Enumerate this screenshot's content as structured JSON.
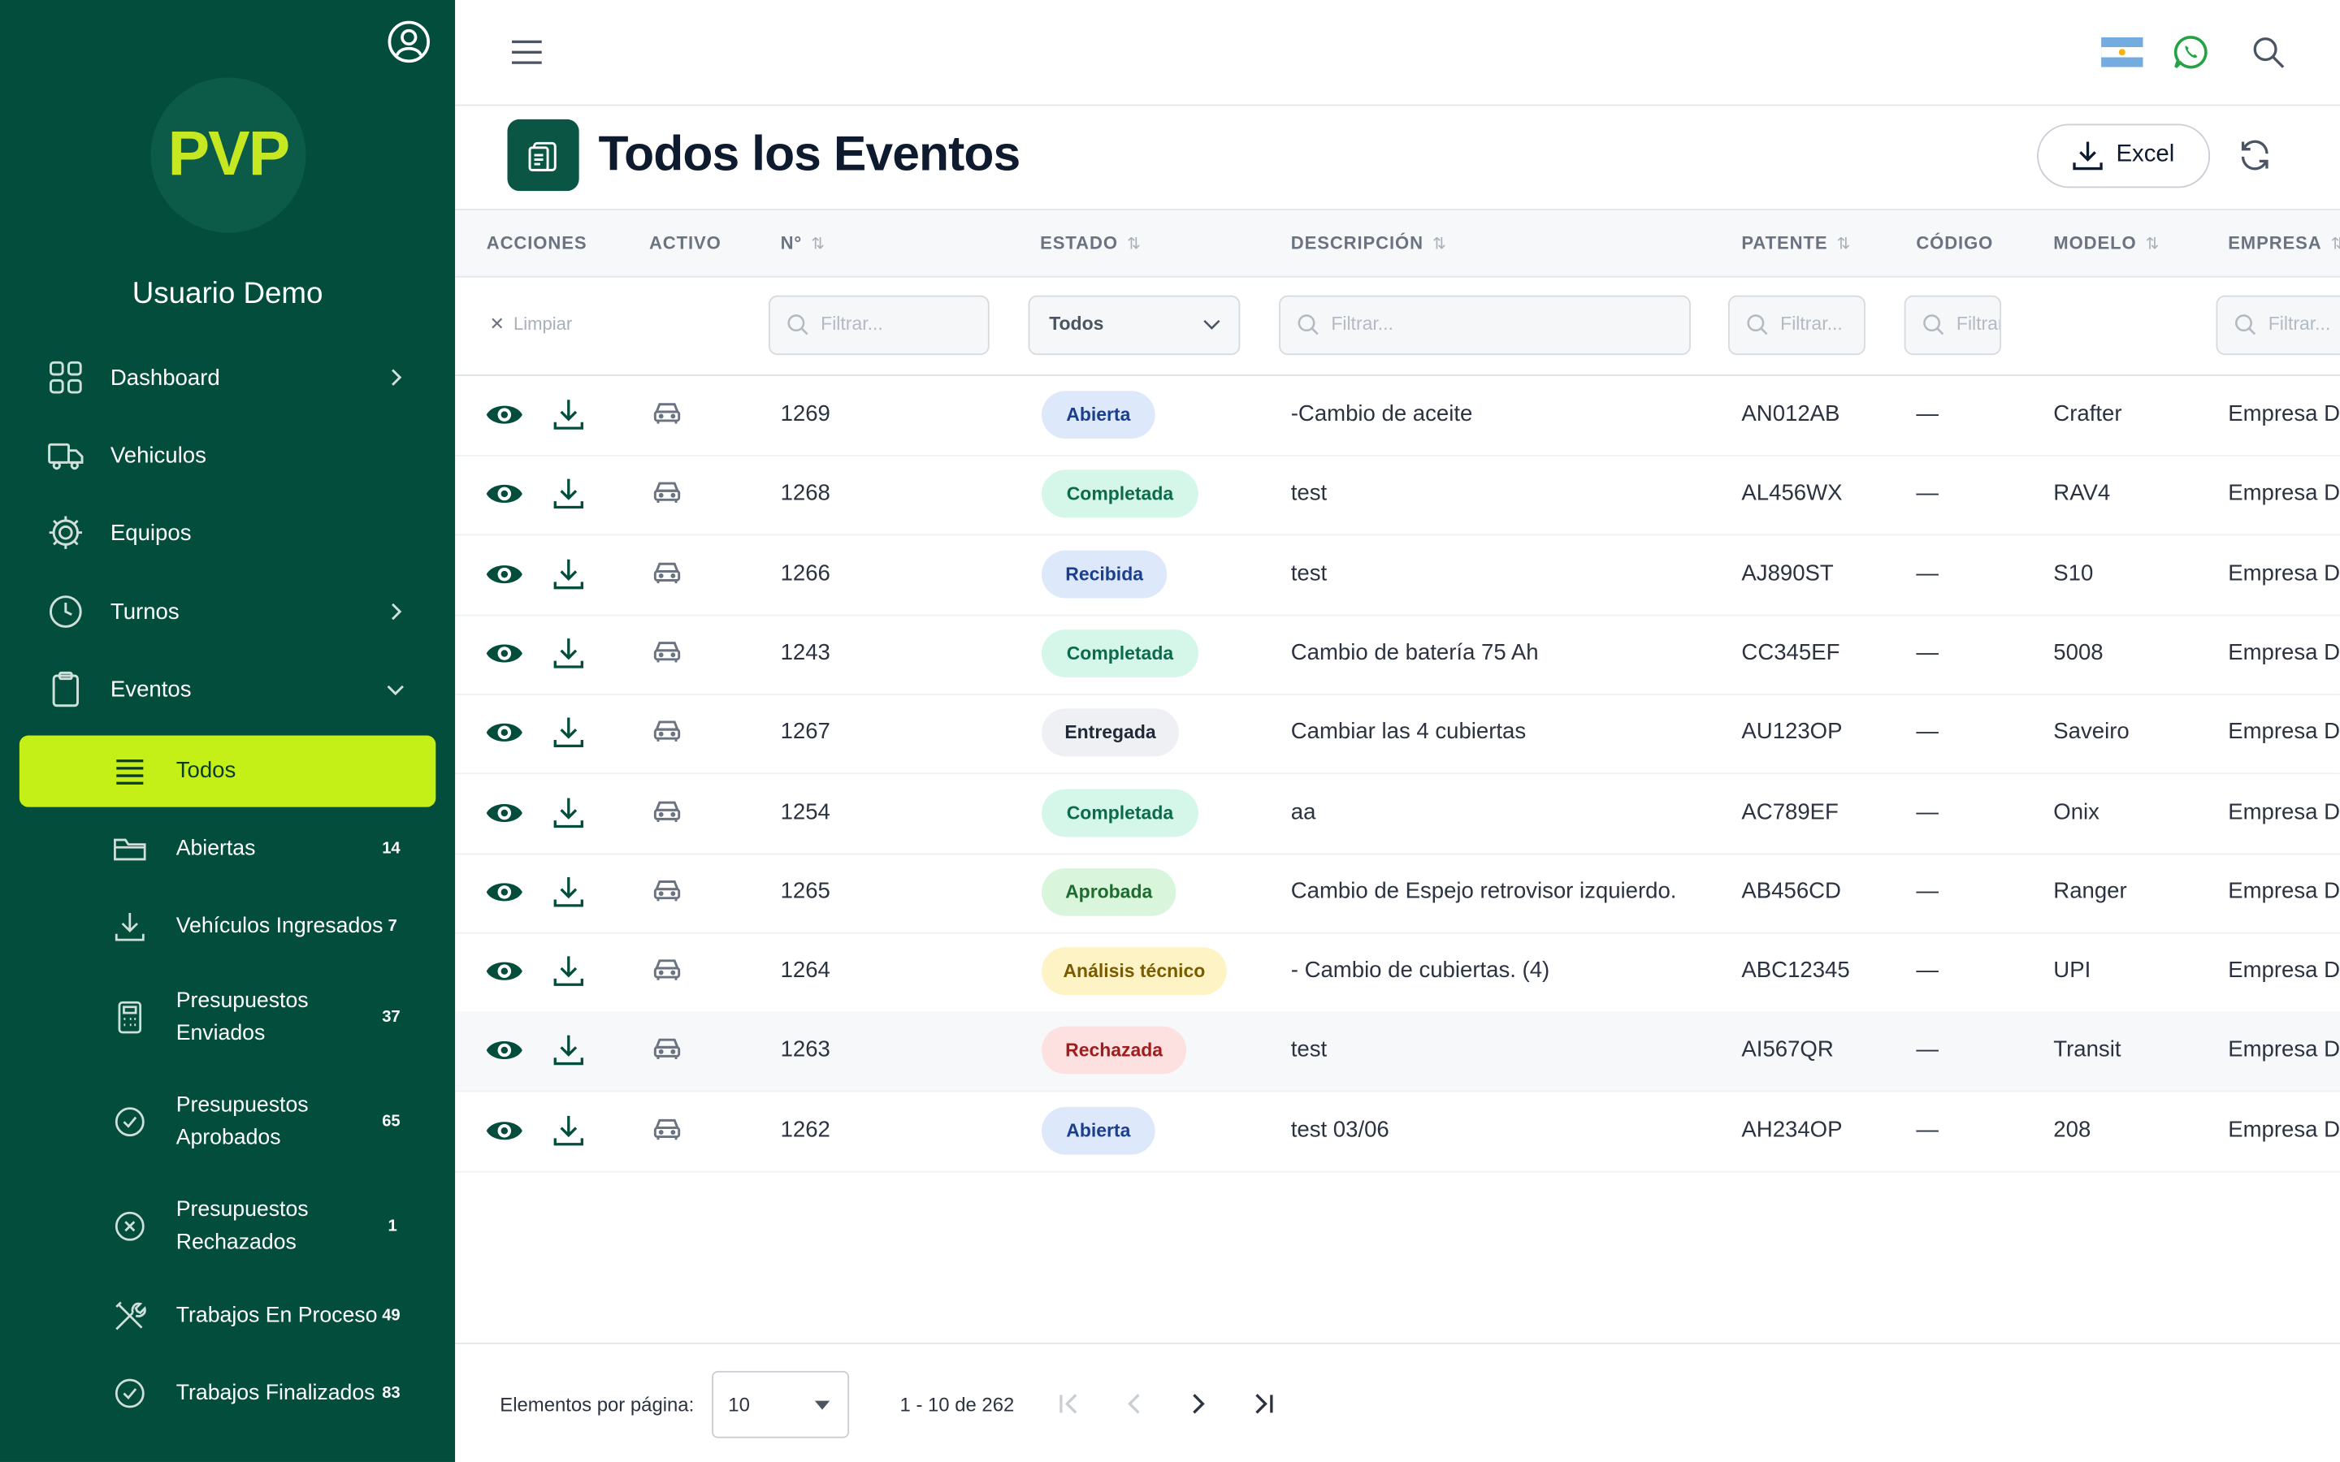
{
  "brand": {
    "logo_text": "PVP"
  },
  "user": {
    "name": "Usuario Demo"
  },
  "nav": {
    "dashboard": "Dashboard",
    "vehiculos": "Vehiculos",
    "equipos": "Equipos",
    "turnos": "Turnos",
    "eventos": "Eventos"
  },
  "sub": [
    {
      "label": "Todos",
      "count": ""
    },
    {
      "label": "Abiertas",
      "count": "14"
    },
    {
      "label": "Vehículos Ingresados",
      "count": "7"
    },
    {
      "label": "Presupuestos",
      "label2": "Enviados",
      "count": "37"
    },
    {
      "label": "Presupuestos",
      "label2": "Aprobados",
      "count": "65"
    },
    {
      "label": "Presupuestos",
      "label2": "Rechazados",
      "count": "1"
    },
    {
      "label": "Trabajos En Proceso",
      "count": "49"
    },
    {
      "label": "Trabajos Finalizados",
      "count": "83"
    }
  ],
  "page": {
    "title": "Todos los Eventos",
    "excel_label": "Excel"
  },
  "columns": {
    "acciones": "ACCIONES",
    "activo": "ACTIVO",
    "numero": "N°",
    "estado": "ESTADO",
    "descripcion": "DESCRIPCIÓN",
    "patente": "PATENTE",
    "codigo": "CÓDIGO",
    "modelo": "MODELO",
    "empresa": "EMPRESA"
  },
  "filters": {
    "clear_label": "Limpiar",
    "numero_placeholder": "Filtrar...",
    "estado_value": "Todos",
    "descripcion_placeholder": "Filtrar...",
    "patente_placeholder": "Filtrar...",
    "codigo_placeholder": "Filtrar...",
    "empresa_placeholder": "Filtrar..."
  },
  "rows": [
    {
      "numero": "1269",
      "estado": "Abierta",
      "descripcion": "-Cambio de aceite",
      "patente": "AN012AB",
      "codigo": "—",
      "modelo": "Crafter",
      "empresa": "Empresa Demo"
    },
    {
      "numero": "1268",
      "estado": "Completada",
      "descripcion": "test",
      "patente": "AL456WX",
      "codigo": "—",
      "modelo": "RAV4",
      "empresa": "Empresa Demo"
    },
    {
      "numero": "1266",
      "estado": "Recibida",
      "descripcion": "test",
      "patente": "AJ890ST",
      "codigo": "—",
      "modelo": "S10",
      "empresa": "Empresa Demo"
    },
    {
      "numero": "1243",
      "estado": "Completada",
      "descripcion": "Cambio de batería 75 Ah",
      "patente": "CC345EF",
      "codigo": "—",
      "modelo": "5008",
      "empresa": "Empresa Demo"
    },
    {
      "numero": "1267",
      "estado": "Entregada",
      "descripcion": "Cambiar las 4 cubiertas",
      "patente": "AU123OP",
      "codigo": "—",
      "modelo": "Saveiro",
      "empresa": "Empresa Demo"
    },
    {
      "numero": "1254",
      "estado": "Completada",
      "descripcion": "aa",
      "patente": "AC789EF",
      "codigo": "—",
      "modelo": "Onix",
      "empresa": "Empresa Demo"
    },
    {
      "numero": "1265",
      "estado": "Aprobada",
      "descripcion": "Cambio de Espejo retrovisor izquierdo.",
      "patente": "AB456CD",
      "codigo": "—",
      "modelo": "Ranger",
      "empresa": "Empresa Demo"
    },
    {
      "numero": "1264",
      "estado": "Análisis técnico",
      "descripcion": "- Cambio de cubiertas. (4)",
      "patente": "ABC12345",
      "codigo": "—",
      "modelo": "UPI",
      "empresa": "Empresa Demo"
    },
    {
      "numero": "1263",
      "estado": "Rechazada",
      "descripcion": "test",
      "patente": "AI567QR",
      "codigo": "—",
      "modelo": "Transit",
      "empresa": "Empresa Demo"
    },
    {
      "numero": "1262",
      "estado": "Abierta",
      "descripcion": "test 03/06",
      "patente": "AH234OP",
      "codigo": "—",
      "modelo": "208",
      "empresa": "Empresa Demo"
    }
  ],
  "status_colors": {
    "Abierta": {
      "bg": "#dde8fb",
      "fg": "#1a3f8f"
    },
    "Completada": {
      "bg": "#d4f7ea",
      "fg": "#0b6b4c"
    },
    "Recibida": {
      "bg": "#dde8fb",
      "fg": "#1a3f8f"
    },
    "Entregada": {
      "bg": "#eef0f3",
      "fg": "#1f2937"
    },
    "Aprobada": {
      "bg": "#d9f5dc",
      "fg": "#1e6b2e"
    },
    "Análisis técnico": {
      "bg": "#fdf3c4",
      "fg": "#7a5b00"
    },
    "Rechazada": {
      "bg": "#fde0e0",
      "fg": "#a11d1d"
    }
  },
  "pagination": {
    "label": "Elementos por página:",
    "page_size": "10",
    "range": "1 - 10 de 262"
  },
  "theme": {
    "sidebar_bg": "#034d3c",
    "accent": "#c5f017",
    "primary": "#0a5543"
  }
}
